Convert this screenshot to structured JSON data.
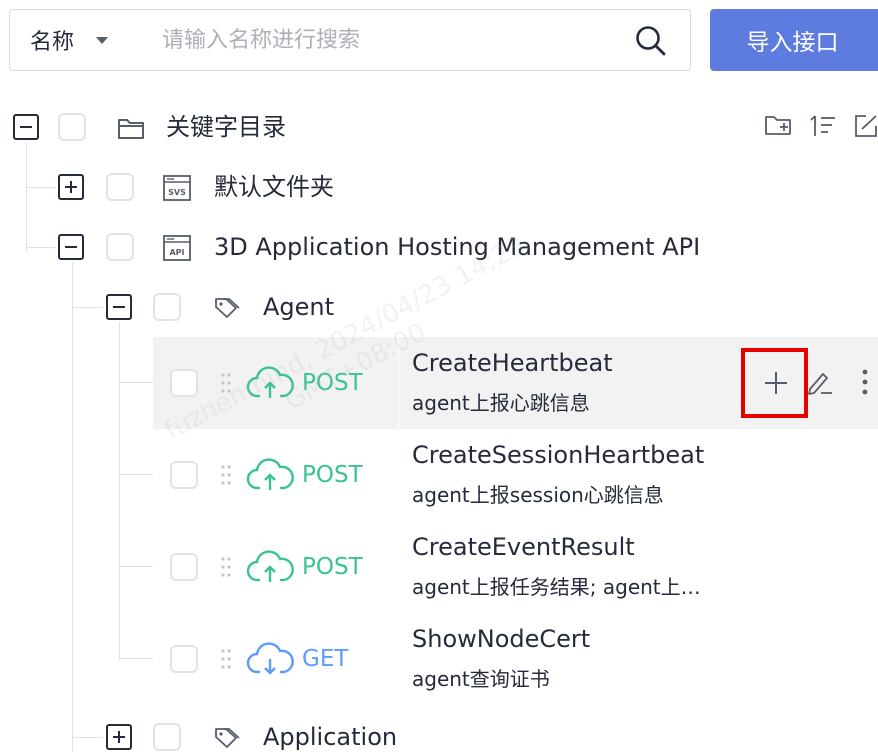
{
  "search": {
    "scope_label": "名称",
    "placeholder": "请输入名称进行搜索",
    "value": ""
  },
  "import_button": {
    "label": "导入接口"
  },
  "tree": {
    "root": {
      "label": "关键字目录",
      "expanded": true
    },
    "folders": [
      {
        "label": "默认文件夹",
        "icon": "svs-folder-icon",
        "expanded": false
      },
      {
        "label": "3D Application Hosting Management API",
        "icon": "api-folder-icon",
        "expanded": true
      }
    ],
    "tags": [
      {
        "label": "Agent",
        "expanded": true
      },
      {
        "label": "Application",
        "expanded": false
      }
    ],
    "apis": [
      {
        "method": "POST",
        "name": "CreateHeartbeat",
        "desc": "agent上报心跳信息",
        "selected": true
      },
      {
        "method": "POST",
        "name": "CreateSessionHeartbeat",
        "desc": "agent上报session心跳信息",
        "selected": false
      },
      {
        "method": "POST",
        "name": "CreateEventResult",
        "desc": "agent上报任务结果; agent上…",
        "selected": false
      },
      {
        "method": "GET",
        "name": "ShowNodeCert",
        "desc": "agent查询证书",
        "selected": false
      }
    ]
  },
  "watermark": {
    "line1": "fuzhenmind, 2024/04/23 14:23",
    "line2": "GMT+08:00"
  },
  "colors": {
    "accent": "#5e7ce0",
    "post": "#3ac295",
    "get": "#5e9bff",
    "highlight": "#e60000"
  }
}
